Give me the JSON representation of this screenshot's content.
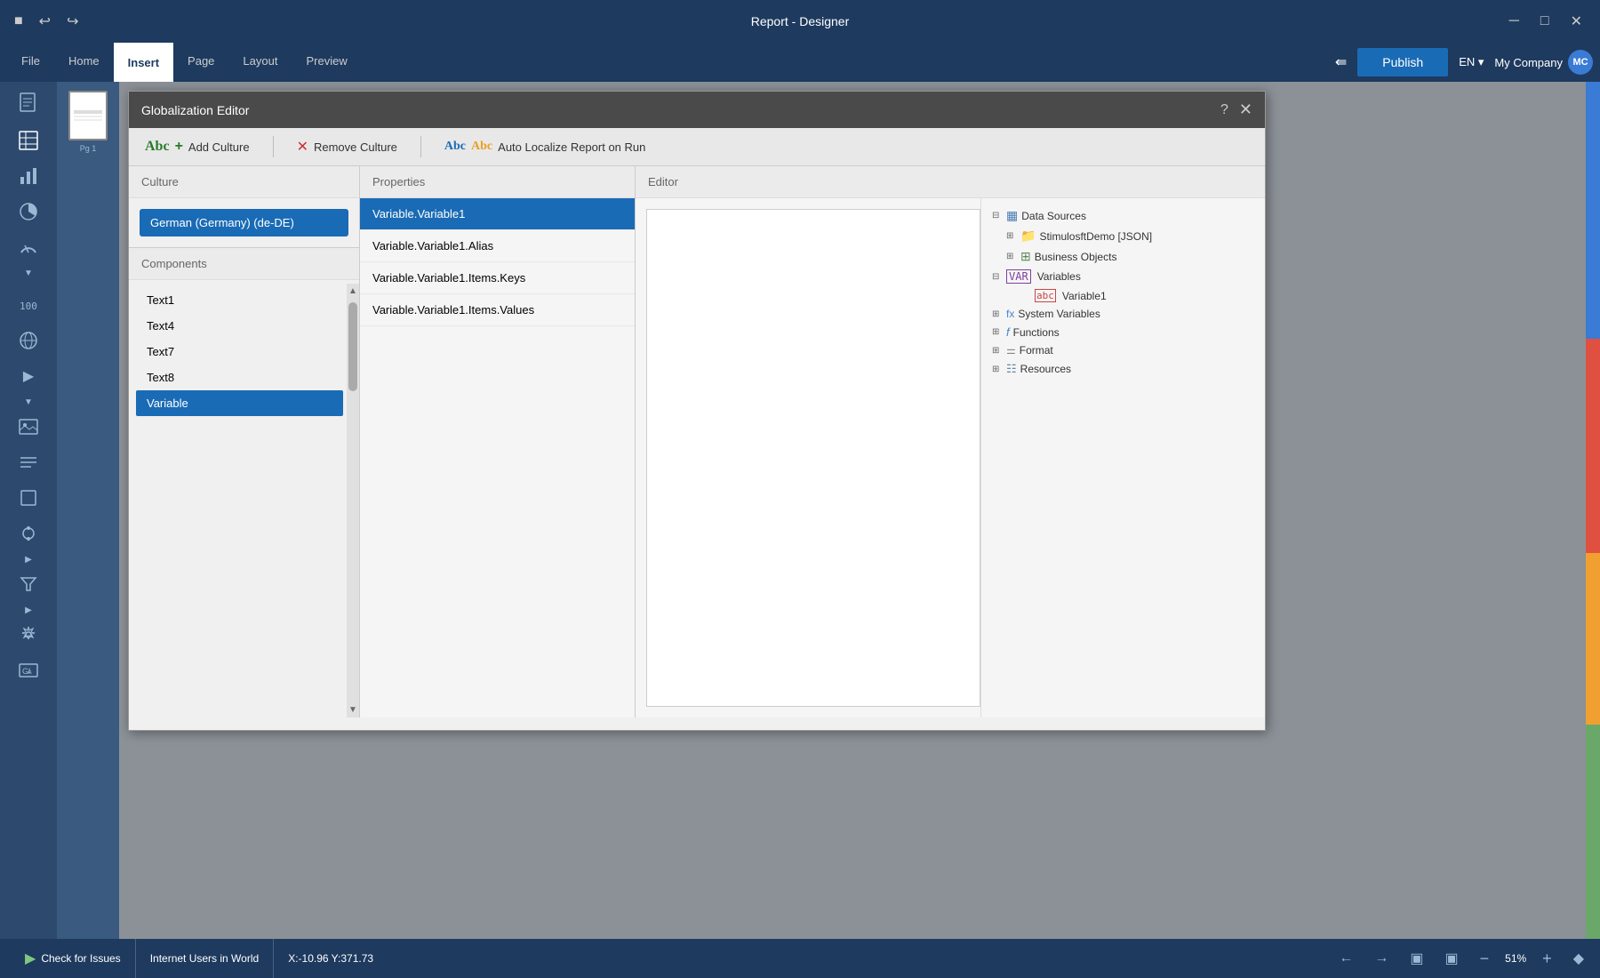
{
  "titleBar": {
    "title": "Report - Designer",
    "minimizeLabel": "─",
    "maximizeLabel": "□",
    "closeLabel": "✕"
  },
  "menuBar": {
    "items": [
      {
        "label": "File",
        "active": false
      },
      {
        "label": "Home",
        "active": false
      },
      {
        "label": "Insert",
        "active": true
      },
      {
        "label": "Page",
        "active": false
      },
      {
        "label": "Layout",
        "active": false
      },
      {
        "label": "Preview",
        "active": false
      }
    ],
    "publish": "Publish",
    "language": "EN",
    "company": "My Company",
    "userInitials": "MC"
  },
  "modal": {
    "title": "Globalization Editor",
    "toolbar": {
      "addCulture": "Add Culture",
      "removeCulture": "Remove Culture",
      "autoLocalize": "Auto Localize Report on Run"
    },
    "culture": {
      "header": "Culture",
      "items": [
        {
          "label": "German (Germany) (de-DE)",
          "selected": true
        }
      ]
    },
    "components": {
      "header": "Components",
      "items": [
        {
          "label": "Text1",
          "selected": false
        },
        {
          "label": "Text4",
          "selected": false
        },
        {
          "label": "Text7",
          "selected": false
        },
        {
          "label": "Text8",
          "selected": false
        },
        {
          "label": "Variable",
          "selected": true
        }
      ]
    },
    "properties": {
      "header": "Properties",
      "items": [
        {
          "label": "Variable.Variable1",
          "selected": true
        },
        {
          "label": "Variable.Variable1.Alias",
          "selected": false
        },
        {
          "label": "Variable.Variable1.Items.Keys",
          "selected": false
        },
        {
          "label": "Variable.Variable1.Items.Values",
          "selected": false
        }
      ]
    },
    "editor": {
      "header": "Editor",
      "tree": {
        "items": [
          {
            "label": "Data Sources",
            "icon": "db",
            "indent": 0,
            "expand": "─",
            "expandIcon": "⊟"
          },
          {
            "label": "StimulosftDemo [JSON]",
            "icon": "folder",
            "indent": 1,
            "expandIcon": "⊞"
          },
          {
            "label": "Business Objects",
            "icon": "obj",
            "indent": 1,
            "expandIcon": "⊞"
          },
          {
            "label": "Variables",
            "icon": "var",
            "indent": 0,
            "expandIcon": "⊟"
          },
          {
            "label": "Variable1",
            "icon": "var2",
            "indent": 2
          },
          {
            "label": "System Variables",
            "icon": "sysvar",
            "indent": 0,
            "expandIcon": "⊞"
          },
          {
            "label": "Functions",
            "icon": "func",
            "indent": 0,
            "expandIcon": "⊞"
          },
          {
            "label": "Format",
            "icon": "fmt",
            "indent": 0,
            "expandIcon": "⊞"
          },
          {
            "label": "Resources",
            "icon": "res",
            "indent": 0,
            "expandIcon": "⊞"
          }
        ]
      }
    }
  },
  "statusBar": {
    "checkIssues": "Check for Issues",
    "reportName": "Internet Users in World",
    "coordinates": "X:-10.96 Y:371.73",
    "zoomLevel": "51%"
  }
}
